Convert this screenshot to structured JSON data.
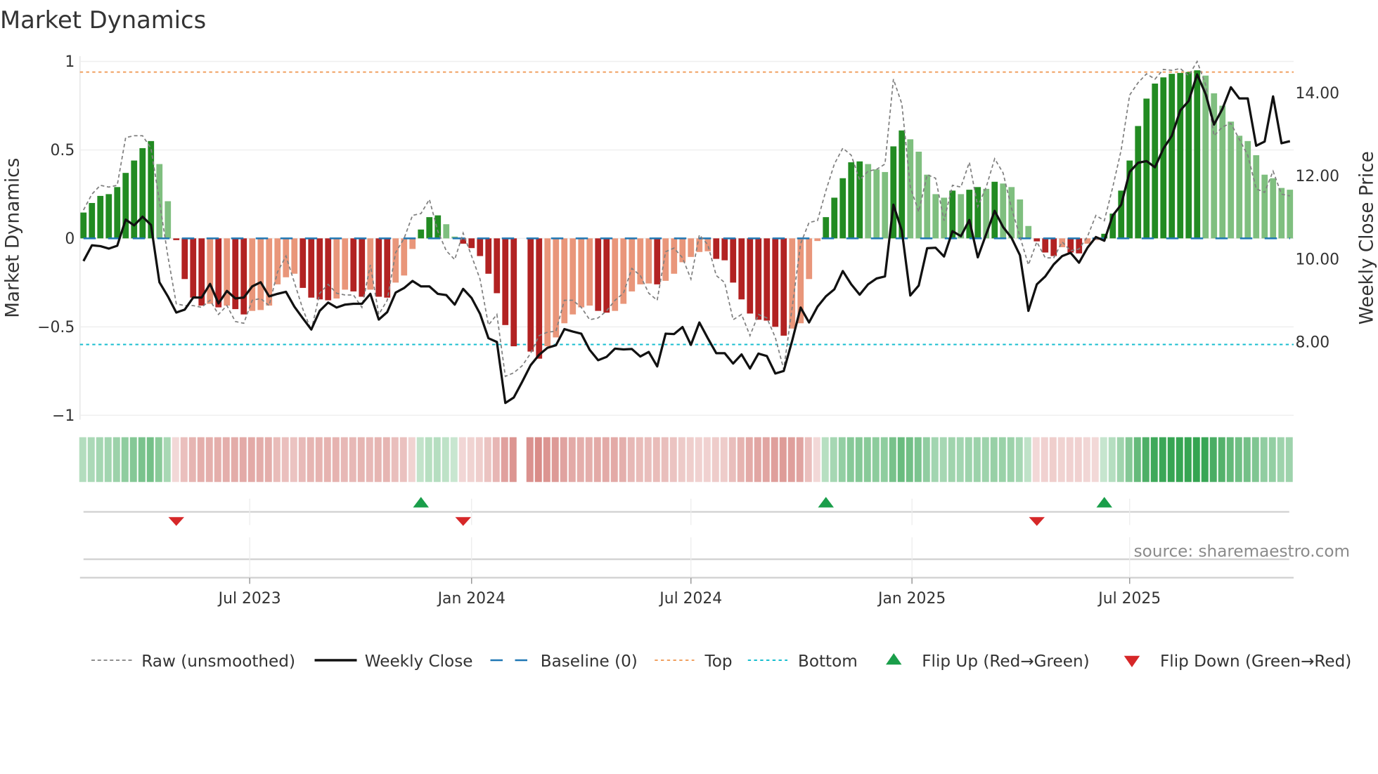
{
  "chart_data": {
    "type": "bar",
    "title": "Market Dynamics",
    "ylabel": "Market Dynamics",
    "y2label": "Weekly Close Price",
    "ylim": [
      -1,
      1
    ],
    "y2lim": [
      6.2,
      15.0
    ],
    "yticks": [
      {
        "v": 1,
        "label": "1"
      },
      {
        "v": 0.5,
        "label": "0.5"
      },
      {
        "v": 0,
        "label": "0"
      },
      {
        "v": -0.5,
        "label": "−0.5"
      },
      {
        "v": -1,
        "label": "−1"
      }
    ],
    "y2ticks": [
      {
        "v": 14,
        "label": "14.00"
      },
      {
        "v": 12,
        "label": "12.00"
      },
      {
        "v": 10,
        "label": "10.00"
      },
      {
        "v": 8,
        "label": "8.00"
      }
    ],
    "x_unit": "week index",
    "xticks": [
      {
        "week": 19.7,
        "label": "Jul 2023"
      },
      {
        "week": 46.0,
        "label": "Jan 2024"
      },
      {
        "week": 72.0,
        "label": "Jul 2024"
      },
      {
        "week": 98.2,
        "label": "Jan 2025"
      },
      {
        "week": 124.0,
        "label": "Jul 2025"
      }
    ],
    "grid": true,
    "top_level": 0.94,
    "bottom_level": -0.6,
    "baseline": 0,
    "momentum": [
      0.146,
      0.2,
      0.24,
      0.25,
      0.29,
      0.37,
      0.44,
      0.51,
      0.55,
      0.42,
      0.21,
      -0.01,
      -0.23,
      -0.335,
      -0.38,
      -0.37,
      -0.39,
      -0.38,
      -0.4,
      -0.43,
      -0.41,
      -0.405,
      -0.38,
      -0.26,
      -0.22,
      -0.2,
      -0.28,
      -0.335,
      -0.345,
      -0.35,
      -0.34,
      -0.29,
      -0.3,
      -0.33,
      -0.29,
      -0.33,
      -0.335,
      -0.25,
      -0.21,
      -0.06,
      0.05,
      0.12,
      0.13,
      0.08,
      0.01,
      -0.03,
      -0.055,
      -0.1,
      -0.2,
      -0.31,
      -0.49,
      -0.61,
      null,
      -0.64,
      -0.68,
      -0.61,
      -0.56,
      -0.48,
      -0.43,
      -0.39,
      -0.38,
      -0.41,
      -0.42,
      -0.41,
      -0.37,
      -0.3,
      -0.26,
      -0.255,
      -0.26,
      -0.24,
      -0.2,
      -0.135,
      -0.105,
      -0.077,
      -0.073,
      -0.116,
      -0.124,
      -0.25,
      -0.345,
      -0.425,
      -0.46,
      -0.465,
      -0.5,
      -0.55,
      -0.51,
      -0.48,
      -0.23,
      -0.015,
      0.12,
      0.23,
      0.34,
      0.43,
      0.435,
      0.42,
      0.39,
      0.375,
      0.52,
      0.61,
      0.56,
      0.49,
      0.36,
      0.25,
      0.23,
      0.27,
      0.25,
      0.275,
      0.29,
      0.28,
      0.32,
      0.31,
      0.29,
      0.22,
      0.07,
      -0.017,
      -0.08,
      -0.1,
      -0.05,
      -0.08,
      -0.085,
      -0.03,
      -0.01,
      0.026,
      0.14,
      0.27,
      0.44,
      0.635,
      0.79,
      0.875,
      0.91,
      0.93,
      0.935,
      0.94,
      0.95,
      0.92,
      0.82,
      0.75,
      0.66,
      0.58,
      0.55,
      0.47,
      0.36,
      0.34,
      0.285,
      0.275
    ],
    "raw": [
      0.16,
      0.25,
      0.3,
      0.29,
      0.3,
      0.57,
      0.58,
      0.58,
      0.51,
      0.21,
      -0.1,
      -0.37,
      -0.38,
      -0.38,
      -0.39,
      -0.35,
      -0.43,
      -0.38,
      -0.47,
      -0.48,
      -0.35,
      -0.34,
      -0.38,
      -0.19,
      -0.1,
      -0.25,
      -0.4,
      -0.52,
      -0.31,
      -0.26,
      -0.31,
      -0.32,
      -0.32,
      -0.39,
      -0.15,
      -0.43,
      -0.35,
      -0.08,
      0.0,
      0.13,
      0.14,
      0.22,
      0.04,
      -0.07,
      -0.12,
      0.03,
      -0.1,
      -0.23,
      -0.49,
      -0.43,
      -0.78,
      -0.76,
      -0.72,
      -0.65,
      -0.55,
      -0.53,
      -0.525,
      -0.35,
      -0.35,
      -0.39,
      -0.46,
      -0.45,
      -0.41,
      -0.35,
      -0.31,
      -0.17,
      -0.21,
      -0.31,
      -0.35,
      -0.075,
      -0.055,
      -0.11,
      -0.23,
      0.02,
      -0.036,
      -0.21,
      -0.25,
      -0.46,
      -0.43,
      -0.55,
      -0.43,
      -0.45,
      -0.56,
      -0.74,
      -0.39,
      -0.03,
      0.09,
      0.1,
      0.27,
      0.42,
      0.51,
      0.47,
      0.33,
      0.38,
      0.39,
      0.42,
      0.9,
      0.76,
      0.29,
      0.15,
      0.36,
      0.34,
      0.1,
      0.3,
      0.29,
      0.43,
      0.18,
      0.29,
      0.45,
      0.37,
      0.17,
      0.01,
      -0.15,
      -0.02,
      -0.11,
      -0.11,
      -0.02,
      -0.07,
      -0.06,
      0.01,
      0.13,
      0.1,
      0.29,
      0.5,
      0.81,
      0.88,
      0.93,
      0.9,
      0.955,
      0.95,
      0.96,
      0.92,
      1.0,
      0.87,
      0.58,
      0.63,
      0.65,
      0.56,
      0.47,
      0.28,
      0.26,
      0.38,
      0.25,
      0.24
    ],
    "close": [
      9.95,
      10.33,
      10.31,
      10.25,
      10.32,
      10.95,
      10.81,
      11.02,
      10.82,
      9.44,
      9.1,
      8.71,
      8.78,
      9.07,
      9.07,
      9.4,
      8.93,
      9.23,
      9.05,
      9.07,
      9.34,
      9.44,
      9.1,
      9.16,
      9.21,
      8.85,
      8.57,
      8.3,
      8.75,
      8.95,
      8.83,
      8.9,
      8.92,
      8.92,
      9.16,
      8.54,
      8.72,
      9.19,
      9.3,
      9.47,
      9.34,
      9.34,
      9.16,
      9.13,
      8.9,
      9.28,
      9.06,
      8.68,
      8.09,
      8.0,
      6.53,
      6.66,
      7.04,
      7.44,
      7.69,
      7.86,
      7.92,
      8.31,
      8.25,
      8.2,
      7.81,
      7.56,
      7.64,
      7.84,
      7.82,
      7.83,
      7.65,
      7.76,
      7.41,
      8.2,
      8.19,
      8.36,
      7.93,
      8.47,
      8.09,
      7.73,
      7.73,
      7.48,
      7.7,
      7.36,
      7.72,
      7.66,
      7.24,
      7.3,
      8.03,
      8.83,
      8.47,
      8.85,
      9.1,
      9.27,
      9.71,
      9.39,
      9.14,
      9.39,
      9.53,
      9.58,
      11.31,
      10.68,
      9.12,
      9.36,
      10.26,
      10.27,
      10.06,
      10.67,
      10.55,
      10.94,
      10.04,
      10.6,
      11.16,
      10.77,
      10.51,
      10.09,
      8.75,
      9.39,
      9.58,
      9.87,
      10.07,
      10.15,
      9.91,
      10.27,
      10.53,
      10.44,
      11.05,
      11.31,
      12.1,
      12.32,
      12.36,
      12.21,
      12.66,
      12.97,
      13.58,
      13.81,
      14.45,
      13.98,
      13.24,
      13.62,
      14.14,
      13.87,
      13.87,
      12.73,
      12.83,
      13.92,
      12.79,
      12.84
    ],
    "flips_up": [
      40,
      88,
      121
    ],
    "flips_down": [
      11,
      45,
      113
    ],
    "colors": {
      "pos_rising": "#228b22",
      "pos_falling": "#7fbf7f",
      "neg_falling": "#b22222",
      "neg_rising": "#e9967a",
      "raw": "#808080",
      "close": "#111111",
      "baseline": "#1f77b4",
      "top": "#f0a060",
      "bottom": "#17becf",
      "flip_up": "#1a9e4a",
      "flip_down": "#d62728",
      "strip_green": "44,160,74",
      "strip_red": "196,78,72"
    },
    "legend": [
      {
        "key": "raw",
        "label": "Raw (unsmoothed)"
      },
      {
        "key": "close",
        "label": "Weekly Close"
      },
      {
        "key": "baseline",
        "label": "Baseline (0)"
      },
      {
        "key": "top",
        "label": "Top"
      },
      {
        "key": "bottom",
        "label": "Bottom"
      },
      {
        "key": "flip_up",
        "label": "Flip Up (Red→Green)"
      },
      {
        "key": "flip_down",
        "label": "Flip Down (Green→Red)"
      }
    ],
    "legend_position": "bottom",
    "source": "source: sharemaestro.com"
  }
}
